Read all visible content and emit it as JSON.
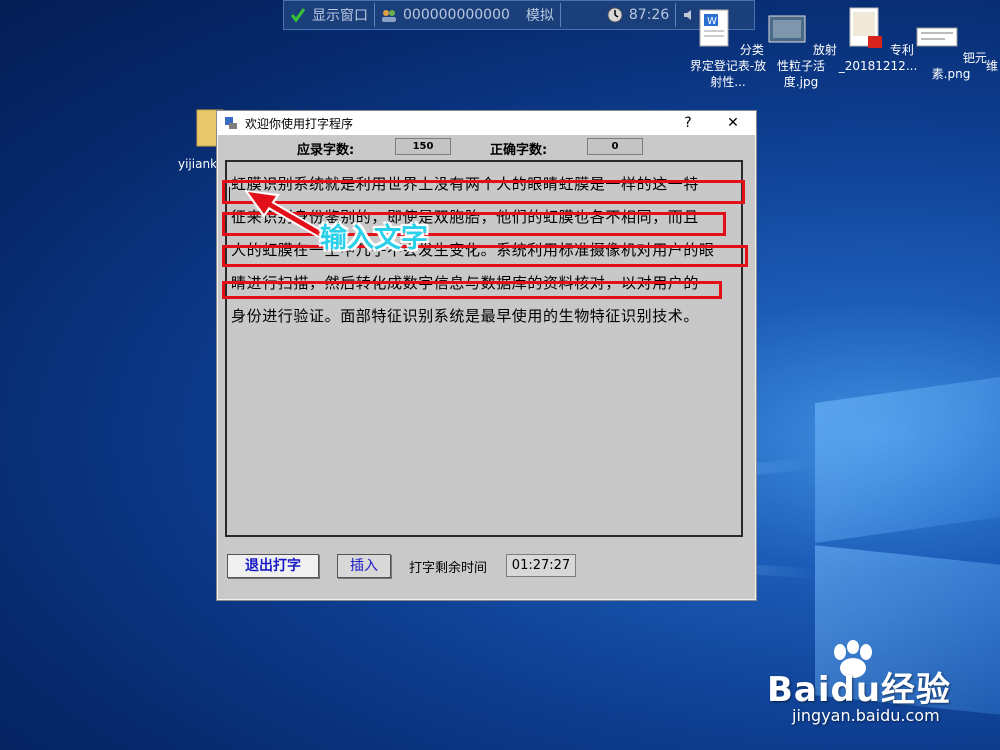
{
  "topbar": {
    "display_window": "显示窗口",
    "account": "000000000000",
    "mode": "模拟",
    "clock": "87:26"
  },
  "desktop_icons": [
    {
      "label": "分类界定登记表-放射性..."
    },
    {
      "label": "放射性粒子活度.jpg"
    },
    {
      "label": "专利_20181212..."
    },
    {
      "label": "钯元素.png"
    },
    {
      "label": "维"
    },
    {
      "label": "yijianka"
    }
  ],
  "window": {
    "title": "欢迎你使用打字程序",
    "help_label": "?",
    "close_label": "✕",
    "should_count_label": "应录字数:",
    "should_count_value": "150",
    "correct_count_label": "正确字数:",
    "correct_count_value": "0",
    "text_lines": [
      "虹膜识别系统就是利用世界上没有两个人的眼睛虹膜是一样的这一特",
      "征来识别身份鉴别的，即使是双胞胎，他们的虹膜也各不相同，而且",
      "人的虹膜在一生中几乎不会发生变化。系统利用标准摄像机对用户的眼",
      "睛进行扫描，然后转化成数字信息与数据库的资料核对，以对用户的",
      "身份进行验证。面部特征识别系统是最早使用的生物特征识别技术。"
    ],
    "exit_button": "退出打字",
    "insert_button": "插入",
    "remaining_label": "打字剩余时间",
    "remaining_time": "01:27:27"
  },
  "annotation": {
    "text": "输入文字",
    "color": "#e3101a"
  },
  "watermark": {
    "brand": "Baidu经验",
    "url": "jingyan.baidu.com"
  }
}
